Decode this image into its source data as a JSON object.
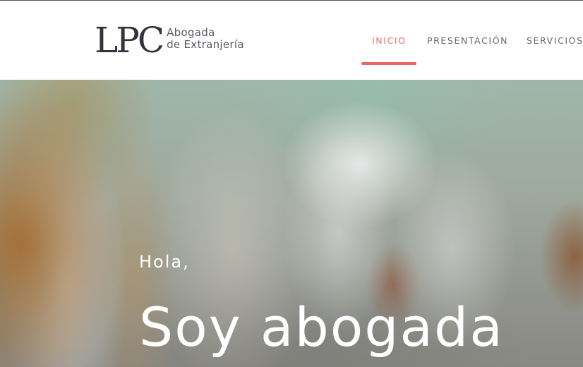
{
  "header": {
    "logo": {
      "mark": "LPC",
      "line1": "Abogada",
      "line2": "de Extranjería"
    },
    "nav": [
      {
        "label": "INICIO",
        "active": true
      },
      {
        "label": "PRESENTACIÓN",
        "active": false
      },
      {
        "label": "SERVICIOS",
        "active": false
      }
    ]
  },
  "hero": {
    "greeting": "Hola,",
    "title": "Soy abogada"
  },
  "colors": {
    "accent": "#ee6d6d",
    "logo": "#33333d",
    "nav_text": "#666666",
    "hero_text": "#ffffff"
  }
}
